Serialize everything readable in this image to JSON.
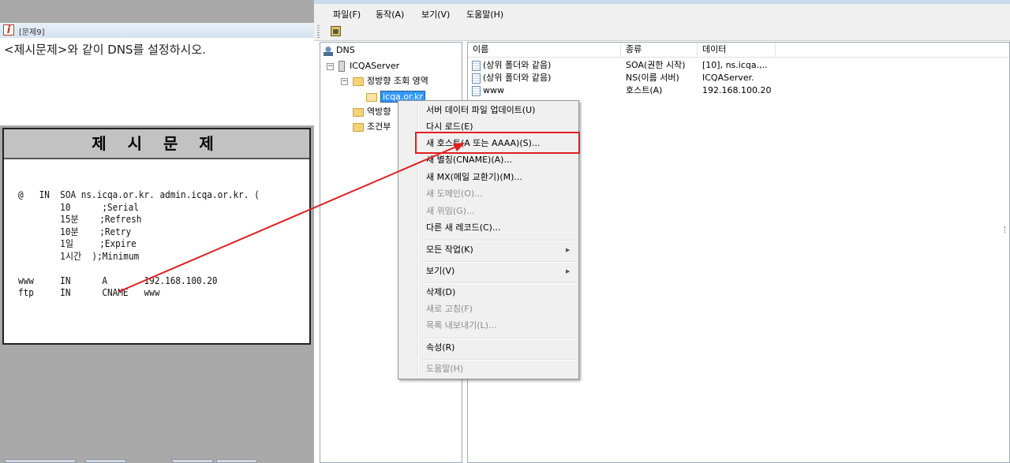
{
  "question": {
    "window_title": "[문제9]",
    "instruction": "<제시문제>와 같이 DNS를 설정하시오.",
    "problem_title": "제 시 문 제",
    "problem_lines": [
      "@   IN  SOA ns.icqa.or.kr. admin.icqa.or.kr. (",
      "        10      ;Serial",
      "        15분    ;Refresh",
      "        10분    ;Retry",
      "        1일     ;Expire",
      "        1시간  );Minimum",
      "",
      "www     IN      A       192.168.100.20",
      "ftp     IN      CNAME   www"
    ]
  },
  "mmc": {
    "menu": [
      "파일(F)",
      "동작(A)",
      "보기(V)",
      "도움말(H)"
    ],
    "toolbar_icon": "properties-icon",
    "tree": {
      "root": "DNS",
      "server": "ICQAServer",
      "forward_zone": "정방향 조회 영역",
      "zone_selected": "icqa.or.kr",
      "reverse_zone": "역방향",
      "conditional": "조건부"
    },
    "list": {
      "columns": [
        "이름",
        "종류",
        "데이터"
      ],
      "rows": [
        {
          "name": "(상위 폴더와 같음)",
          "type": "SOA(권한 시작)",
          "data": "[10], ns.icqa.,.."
        },
        {
          "name": "(상위 폴더와 같음)",
          "type": "NS(이름 서버)",
          "data": "ICQAServer."
        },
        {
          "name": "www",
          "type": "호스트(A)",
          "data": "192.168.100.20"
        }
      ]
    }
  },
  "context_menu": {
    "items": [
      {
        "label": "서버 데이터 파일 업데이트(U)",
        "enabled": true
      },
      {
        "label": "다시 로드(E)",
        "enabled": true
      },
      {
        "label": "새 호스트(A 또는 AAAA)(S)...",
        "enabled": true,
        "highlighted": true
      },
      {
        "label": "새 별칭(CNAME)(A)...",
        "enabled": true
      },
      {
        "label": "새 MX(메일 교환기)(M)...",
        "enabled": true
      },
      {
        "label": "새 도메인(O)...",
        "enabled": false
      },
      {
        "label": "새 위임(G)...",
        "enabled": false
      },
      {
        "label": "다른 새 레코드(C)...",
        "enabled": true
      },
      {
        "label": "모든 작업(K)",
        "enabled": true,
        "submenu": true
      },
      {
        "label": "보기(V)",
        "enabled": true,
        "submenu": true
      },
      {
        "label": "삭제(D)",
        "enabled": true
      },
      {
        "label": "새로 고침(F)",
        "enabled": false
      },
      {
        "label": "목록 내보내기(L)...",
        "enabled": false
      },
      {
        "label": "속성(R)",
        "enabled": true
      },
      {
        "label": "도움말(H)",
        "enabled": false
      }
    ]
  },
  "colors": {
    "annotation": "#e02020",
    "selection": "#3399ff",
    "background": "#a9a9a9"
  }
}
